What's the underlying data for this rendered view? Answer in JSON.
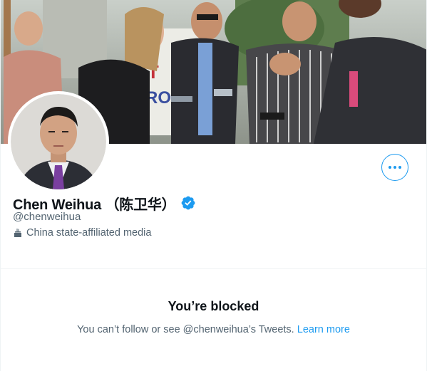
{
  "profile": {
    "display_name": "Chen Weihua （陈卫华）",
    "handle": "@chenweihua",
    "state_label": "China state-affiliated media",
    "state_label_icon": "podium-icon",
    "verified_icon": "verified-badge-icon",
    "more_icon": "more-dots-icon"
  },
  "blocked": {
    "title": "You’re blocked",
    "message": "You can’t follow or see @chenweihua’s Tweets.",
    "learn_more": "Learn more"
  },
  "colors": {
    "accent": "#1d9bf0",
    "secondary_text": "#536471",
    "primary_text": "#0f1419",
    "divider": "#eff3f4"
  }
}
